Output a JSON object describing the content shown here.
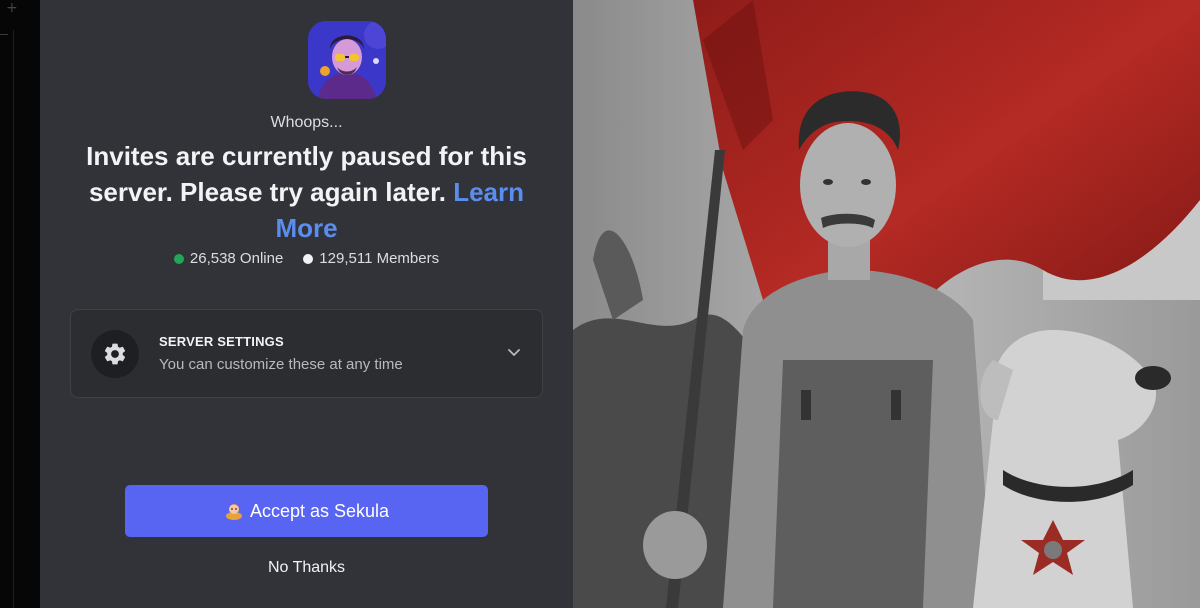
{
  "invite": {
    "intro": "Whoops...",
    "message": "Invites are currently paused for this server. Please try again later.",
    "learn_more": "Learn More",
    "online_count": "26,538 Online",
    "member_count": "129,511 Members"
  },
  "settings": {
    "title": "SERVER SETTINGS",
    "subtitle": "You can customize these at any time"
  },
  "actions": {
    "accept_label": "Accept as Sekula",
    "decline_label": "No Thanks"
  },
  "colors": {
    "primary_button": "#5865f2",
    "online_dot": "#23a55a",
    "link": "#5b8def",
    "card_bg": "#313338",
    "flag_red": "#a8231f"
  },
  "icons": {
    "settings": "gear-icon",
    "expand": "chevron-down-icon",
    "accept": "user-emoji-icon"
  }
}
